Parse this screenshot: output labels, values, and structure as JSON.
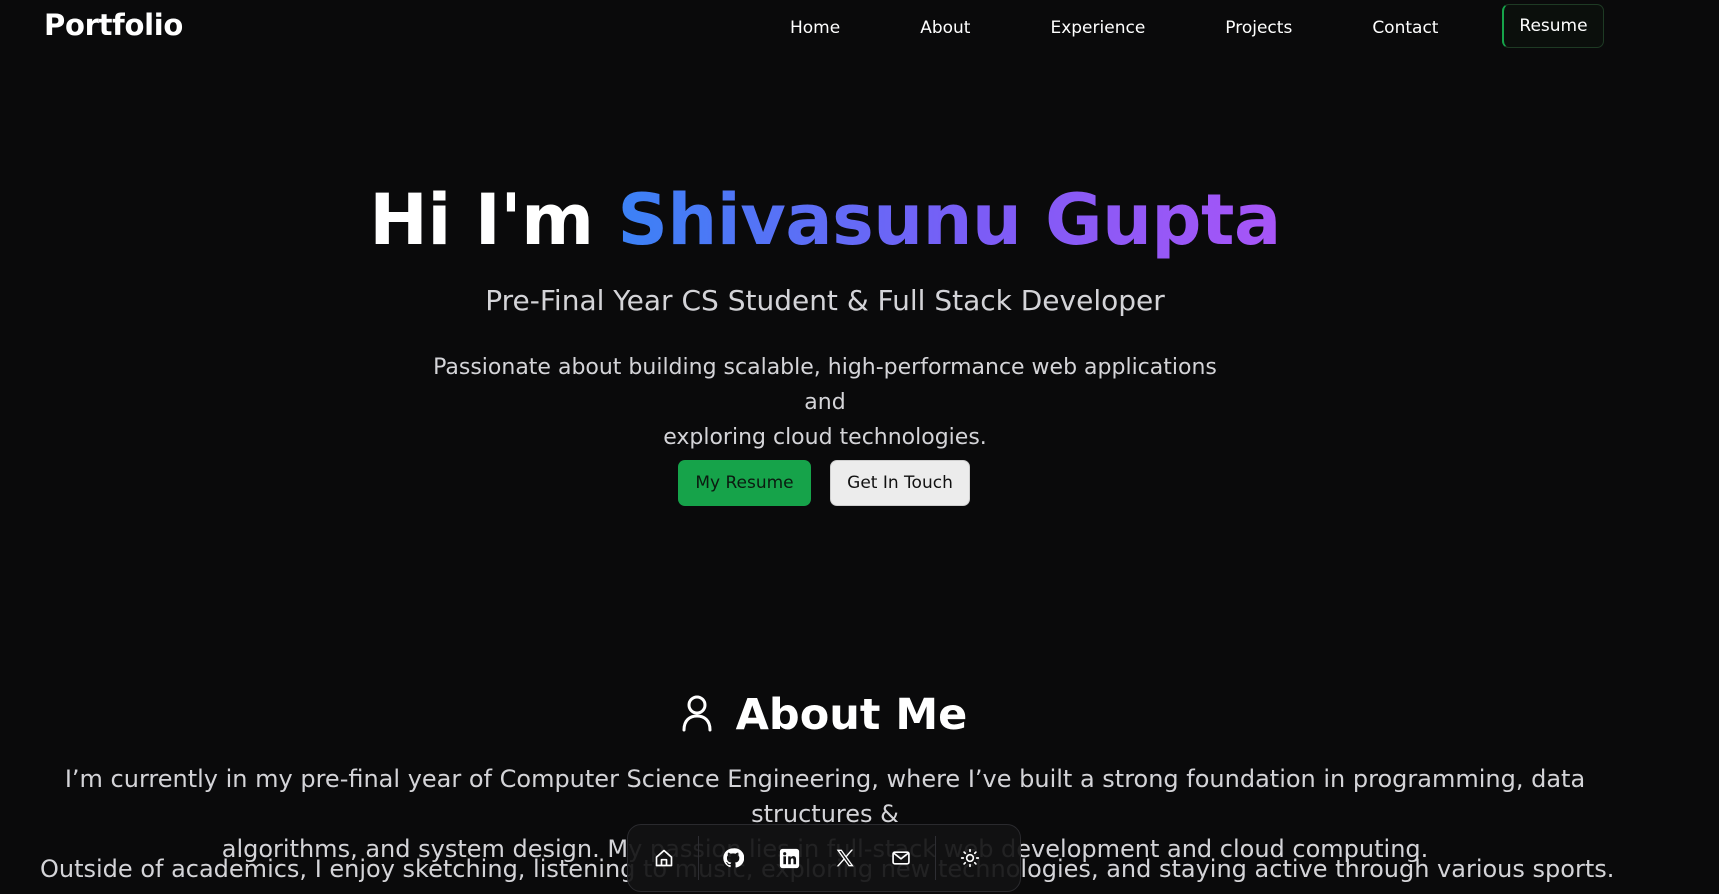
{
  "nav": {
    "brand": "Portfolio",
    "links": [
      "Home",
      "About",
      "Experience",
      "Projects",
      "Contact"
    ],
    "resume_label": "Resume"
  },
  "hero": {
    "greeting": "Hi I'm",
    "name": "Shivasunu Gupta",
    "subtitle": "Pre-Final Year CS Student & Full Stack Developer",
    "desc_line1": "Passionate about building scalable, high-performance web applications and",
    "desc_line2": "exploring cloud technologies.",
    "primary_button": "My Resume",
    "secondary_button": "Get In Touch"
  },
  "about": {
    "title": "About Me",
    "p1_line1": "I’m currently in my pre-final year of Computer Science Engineering, where I’ve built a strong foundation in programming, data structures &",
    "p1_line2": "algorithms, and system design. My passion lies in full-stack web development and cloud computing.",
    "p2": "Outside of academics, I enjoy sketching, listening to music, exploring new technologies, and staying active through various sports."
  },
  "dock": {
    "icons": [
      "home-icon",
      "github-icon",
      "linkedin-icon",
      "x-icon",
      "mail-icon",
      "sun-icon"
    ]
  },
  "colors": {
    "background": "#0a0a0b",
    "accent_green": "#16a34a",
    "gradient_start": "#3b82f6",
    "gradient_end": "#a855f7"
  }
}
